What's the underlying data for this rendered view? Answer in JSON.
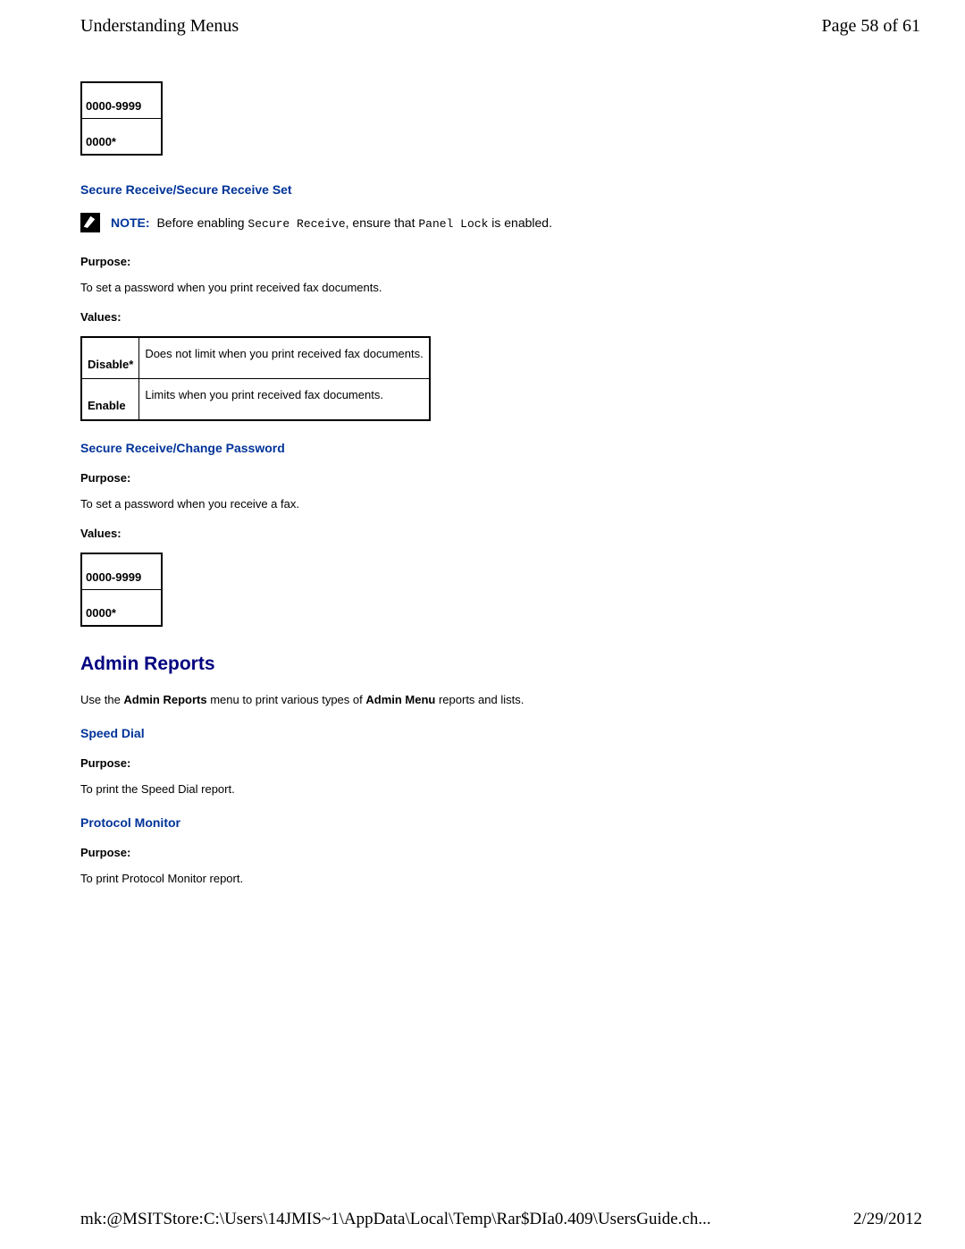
{
  "header": {
    "title": "Understanding Menus",
    "page": "Page 58 of 61"
  },
  "range_table_1": {
    "row1": "0000-9999",
    "row2": "0000*"
  },
  "secure_receive_set": {
    "heading": "Secure Receive/Secure Receive Set",
    "note_label": "NOTE:",
    "note_before": " Before enabling ",
    "note_code1": "Secure Receive",
    "note_mid": ", ensure that ",
    "note_code2": "Panel Lock",
    "note_after": " is enabled.",
    "purpose_label": "Purpose:",
    "purpose_text": "To set a password when you print received fax documents.",
    "values_label": "Values:",
    "table": [
      {
        "opt": "Disable*",
        "desc": "Does not limit when you print received fax documents."
      },
      {
        "opt": "Enable",
        "desc": "Limits when you print received fax documents."
      }
    ]
  },
  "change_password": {
    "heading": "Secure Receive/Change Password",
    "purpose_label": "Purpose:",
    "purpose_text": "To set a password when you receive a fax.",
    "values_label": "Values:"
  },
  "range_table_2": {
    "row1": "0000-9999",
    "row2": "0000*"
  },
  "admin_reports": {
    "heading": "Admin Reports",
    "intro_pre": "Use the ",
    "intro_b1": "Admin Reports",
    "intro_mid": " menu to print various types of ",
    "intro_b2": "Admin Menu",
    "intro_post": " reports and lists."
  },
  "speed_dial": {
    "heading": "Speed Dial",
    "purpose_label": "Purpose:",
    "purpose_text": "To print the Speed Dial report."
  },
  "protocol_monitor": {
    "heading": "Protocol Monitor",
    "purpose_label": "Purpose:",
    "purpose_text": "To print Protocol Monitor report."
  },
  "footer": {
    "path": "mk:@MSITStore:C:\\Users\\14JMIS~1\\AppData\\Local\\Temp\\Rar$DIa0.409\\UsersGuide.ch...",
    "date": "2/29/2012"
  }
}
